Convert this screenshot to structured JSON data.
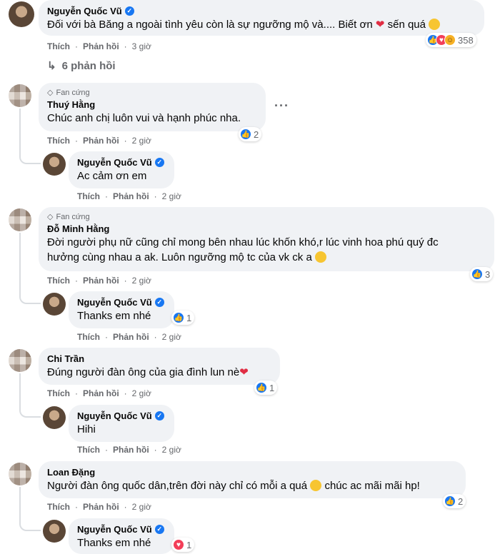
{
  "comments": [
    {
      "name": "Nguyễn Quốc Vũ",
      "text_a": "Đối với bà Băng a ngoài tình yêu còn là sự ngưỡng mộ và.... Biết ơn",
      "text_b": "sến quá",
      "like": "Thích",
      "reply": "Phản hồi",
      "time": "3 giờ",
      "reactions": "358",
      "replies_link": "6 phản hồi"
    },
    {
      "badge": "Fan cứng",
      "name": "Thuý Hằng",
      "text": "Chúc anh chị luôn vui và hạnh phúc nha.",
      "like": "Thích",
      "reply": "Phản hồi",
      "time": "2 giờ",
      "reactions": "2"
    },
    {
      "name": "Nguyễn Quốc Vũ",
      "text": "Ac cảm ơn em",
      "like": "Thích",
      "reply": "Phản hồi",
      "time": "2 giờ"
    },
    {
      "badge": "Fan cứng",
      "name": "Đỗ Minh Hằng",
      "text_line1": "Đời người phụ nữ cũng chỉ mong bên nhau lúc khốn khó,r lúc vinh hoa phú quý đc",
      "text_line2": "hưởng cùng nhau a ak. Luôn ngưỡng mộ tc của vk ck a",
      "like": "Thích",
      "reply": "Phản hồi",
      "time": "2 giờ",
      "reactions": "3"
    },
    {
      "name": "Nguyễn Quốc Vũ",
      "text": "Thanks em nhé",
      "like": "Thích",
      "reply": "Phản hồi",
      "time": "2 giờ",
      "reactions": "1"
    },
    {
      "name": "Chi Trần",
      "text": "Đúng người đàn ông của gia đình lun nè",
      "like": "Thích",
      "reply": "Phản hồi",
      "time": "2 giờ",
      "reactions": "1"
    },
    {
      "name": "Nguyễn Quốc Vũ",
      "text": "Hihi",
      "like": "Thích",
      "reply": "Phản hồi",
      "time": "2 giờ"
    },
    {
      "name": "Loan Đặng",
      "text_a": "Người đàn ông quốc dân,trên đời này chỉ có mỗi a quá",
      "text_b": "chúc ac mãi mãi hp!",
      "like": "Thích",
      "reply": "Phản hồi",
      "time": "2 giờ",
      "reactions": "2"
    },
    {
      "name": "Nguyễn Quốc Vũ",
      "text": "Thanks em nhé",
      "reactions": "1"
    }
  ],
  "icons": {
    "verified": "verified-badge-icon",
    "like": "like-reaction-icon",
    "love": "love-reaction-icon",
    "haha": "haha-reaction-icon",
    "diamond": "diamond-icon",
    "reply_arrow": "reply-arrow-icon",
    "more": "more-options-icon"
  },
  "colors": {
    "bubble": "#f0f2f5",
    "like_blue": "#1877f2",
    "love_red": "#f33e58",
    "meta_gray": "#65676b"
  }
}
